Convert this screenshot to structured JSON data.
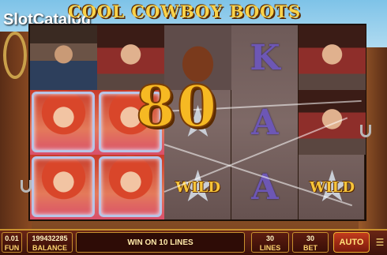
{
  "branding": {
    "logo_text_1": "Slot",
    "logo_text_2": "Catalog",
    "game_title": "COOL COWBOY BOOTS"
  },
  "reels": [
    [
      "man",
      "lady-red",
      "lady-red"
    ],
    [
      "lady",
      "lady-red",
      "lady-red"
    ],
    [
      "hat",
      "wild-star",
      "wild-star"
    ],
    [
      "K",
      "A",
      "A"
    ],
    [
      "lady",
      "lady",
      "wild"
    ]
  ],
  "symbols": {
    "K": "K",
    "A": "A",
    "wild_label": "WILD"
  },
  "win": {
    "amount": "80"
  },
  "bottom_bar": {
    "fun_value": "0.01",
    "fun_label": "FUN",
    "balance_value": "199432285",
    "balance_label": "BALANCE",
    "message": "WIN ON 10 LINES",
    "lines_value": "30",
    "lines_label": "LINES",
    "bet_value": "30",
    "bet_label": "BET",
    "auto_label": "AUTO"
  },
  "colors": {
    "title_gold": "#f8d24a",
    "win_gold": "#f6b923",
    "accent_border": "#c8912e",
    "card_purple": "#6d57b5"
  }
}
